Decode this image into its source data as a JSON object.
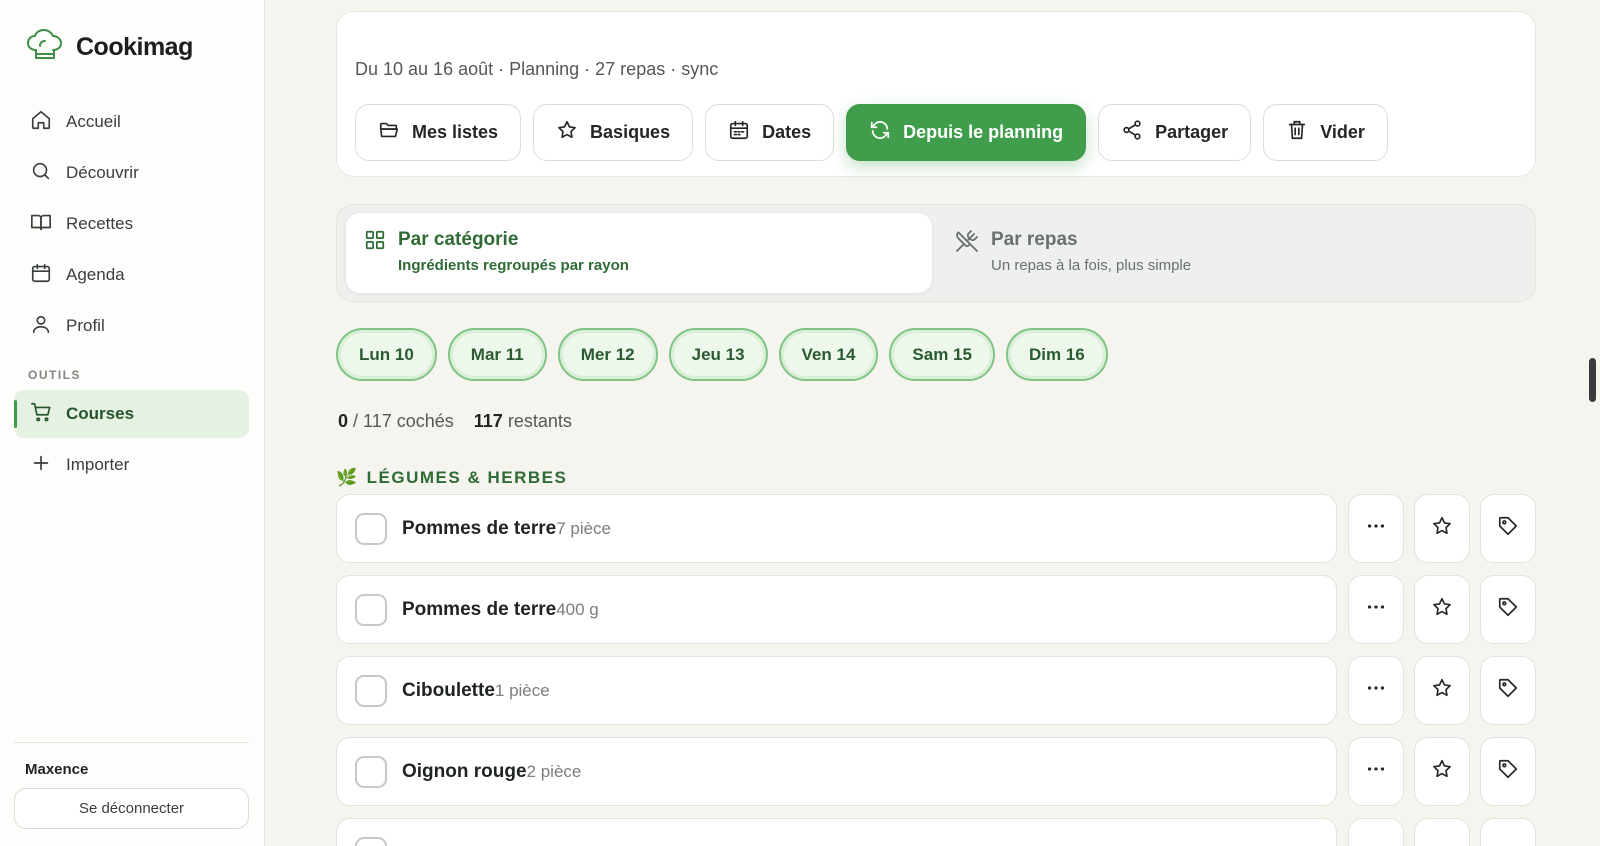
{
  "brand": {
    "name": "Cookimag",
    "icon": "chef-hat-icon"
  },
  "nav": {
    "items": [
      {
        "label": "Accueil",
        "icon": "home-icon"
      },
      {
        "label": "Découvrir",
        "icon": "search-icon"
      },
      {
        "label": "Recettes",
        "icon": "book-icon"
      },
      {
        "label": "Agenda",
        "icon": "calendar-icon"
      },
      {
        "label": "Profil",
        "icon": "user-icon"
      }
    ],
    "tools_label": "OUTILS",
    "tools": [
      {
        "label": "Courses",
        "icon": "cart-icon",
        "active": true
      },
      {
        "label": "Importer",
        "icon": "plus-icon"
      }
    ]
  },
  "user": {
    "name": "Maxence",
    "logout_label": "Se déconnecter"
  },
  "summary": "Du 10 au 16 août · Planning · 27 repas · sync",
  "actions": [
    {
      "label": "Mes listes",
      "icon": "folder-icon"
    },
    {
      "label": "Basiques",
      "icon": "star-icon"
    },
    {
      "label": "Dates",
      "icon": "calendar-icon"
    },
    {
      "label": "Depuis le planning",
      "icon": "refresh-icon",
      "primary": true
    },
    {
      "label": "Partager",
      "icon": "share-icon"
    },
    {
      "label": "Vider",
      "icon": "trash-icon"
    }
  ],
  "modes": {
    "category": {
      "title": "Par catégorie",
      "subtitle": "Ingrédients regroupés par rayon",
      "icon": "grid-icon"
    },
    "meal": {
      "title": "Par repas",
      "subtitle": "Un repas à la fois, plus simple",
      "icon": "utensils-crossed-icon"
    }
  },
  "days": [
    "Lun 10",
    "Mar 11",
    "Mer 12",
    "Jeu 13",
    "Ven 14",
    "Sam 15",
    "Dim 16"
  ],
  "counts": {
    "checked": "0",
    "checked_suffix": "/ 117 cochés",
    "remaining": "117",
    "remaining_suffix": "restants"
  },
  "category": {
    "emoji": "🌿",
    "title": "LÉGUMES & HERBES"
  },
  "items": [
    {
      "name": "Pommes de terre",
      "qty": "7 pièce"
    },
    {
      "name": "Pommes de terre",
      "qty": "400 g"
    },
    {
      "name": "Ciboulette",
      "qty": "1 pièce"
    },
    {
      "name": "Oignon rouge",
      "qty": "2 pièce"
    },
    {
      "name": "",
      "qty": ""
    }
  ],
  "colors": {
    "accent": "#3f9d4b",
    "accent_dark": "#2f6b35",
    "active_bg": "#e5f2e3"
  }
}
